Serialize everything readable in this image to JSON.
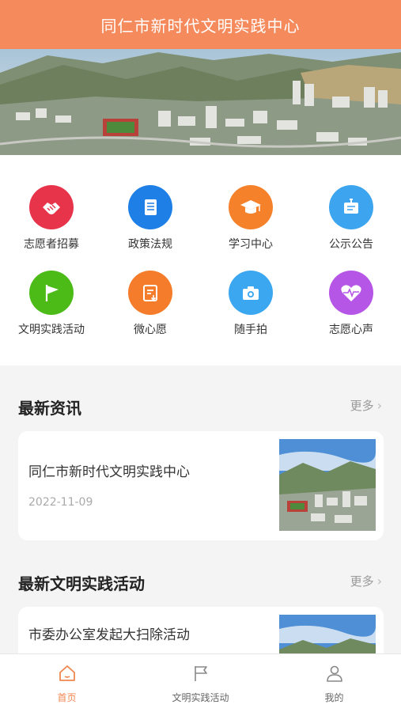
{
  "header": {
    "title": "同仁市新时代文明实践中心"
  },
  "grid": {
    "items": [
      {
        "label": "志愿者招募",
        "icon": "handshake-icon",
        "color": "#e8344a"
      },
      {
        "label": "政策法规",
        "icon": "document-icon",
        "color": "#1e7fe6"
      },
      {
        "label": "学习中心",
        "icon": "graduation-cap-icon",
        "color": "#f5822b"
      },
      {
        "label": "公示公告",
        "icon": "notice-board-icon",
        "color": "#3da4ef"
      },
      {
        "label": "文明实践活动",
        "icon": "flag-icon",
        "color": "#4cbb18"
      },
      {
        "label": "微心愿",
        "icon": "wish-list-icon",
        "color": "#f57c2a"
      },
      {
        "label": "随手拍",
        "icon": "camera-icon",
        "color": "#3aa7f0"
      },
      {
        "label": "志愿心声",
        "icon": "heart-pulse-icon",
        "color": "#b656e6"
      }
    ]
  },
  "news": {
    "title": "最新资讯",
    "more": "更多",
    "items": [
      {
        "title": "同仁市新时代文明实践中心",
        "date": "2022-11-09"
      }
    ]
  },
  "activities": {
    "title": "最新文明实践活动",
    "more": "更多",
    "items": [
      {
        "title": "市委办公室发起大扫除活动"
      }
    ]
  },
  "tabbar": {
    "tabs": [
      {
        "label": "首页",
        "icon": "home-icon",
        "active": true
      },
      {
        "label": "文明实践活动",
        "icon": "flag-icon",
        "active": false
      },
      {
        "label": "我的",
        "icon": "user-icon",
        "active": false
      }
    ]
  },
  "colors": {
    "header": "#f58a5c",
    "accent": "#f0864f"
  }
}
